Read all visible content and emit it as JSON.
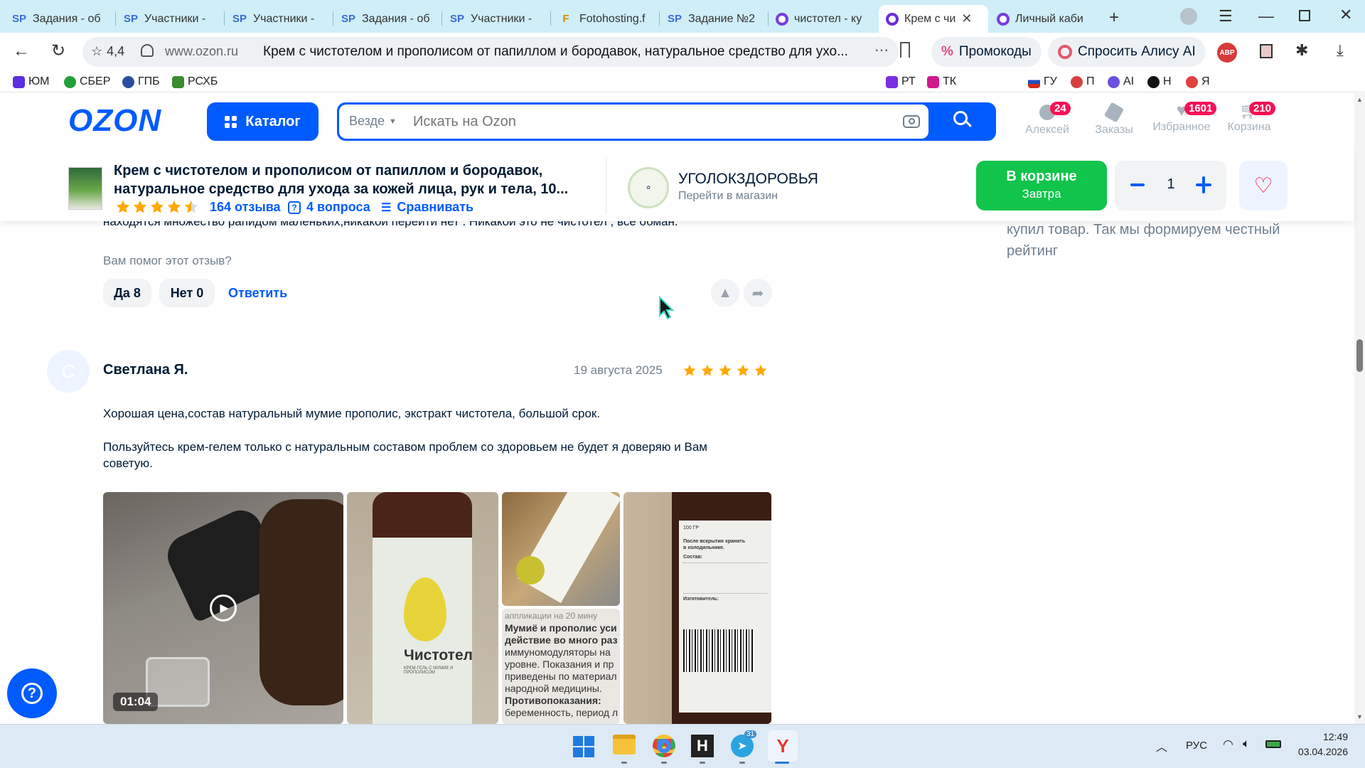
{
  "browser": {
    "tabs": [
      {
        "icon": "SP",
        "label": "Задания - об"
      },
      {
        "icon": "SP",
        "label": "Участники - "
      },
      {
        "icon": "SP",
        "label": "Участники - "
      },
      {
        "icon": "SP",
        "label": "Задания - об"
      },
      {
        "icon": "SP",
        "label": "Участники - "
      },
      {
        "icon": "F",
        "label": "Fotohosting.f"
      },
      {
        "icon": "SP",
        "label": "Задание №2"
      },
      {
        "icon": "ring",
        "label": "чистотел - ку"
      },
      {
        "icon": "ring",
        "label": "Крем с чи"
      },
      {
        "icon": "ring",
        "label": "Личный каби"
      }
    ],
    "rating": "4,4",
    "domain": "www.ozon.ru",
    "page_title": "Крем с чистотелом и прополисом от папиллом и бородавок, натуральное средство для ухо...",
    "promo_label": "Промокоды",
    "alice_label": "Спросить Алису AI",
    "bookmarks": [
      "ЮМ",
      "СБЕР",
      "ГПБ",
      "РСХБ",
      "РТ",
      "ТК",
      "ГУ",
      "П",
      "AI",
      "Н",
      "Я"
    ]
  },
  "ozon": {
    "logo": "OZON",
    "catalog_label": "Каталог",
    "search_scope": "Везде",
    "search_placeholder": "Искать на Ozon",
    "nav": [
      {
        "label": "Алексей",
        "badge": "24"
      },
      {
        "label": "Заказы",
        "badge": ""
      },
      {
        "label": "Избранное",
        "badge": "1601"
      },
      {
        "label": "Корзина",
        "badge": "210"
      }
    ],
    "product": {
      "title_line1": "Крем с чистотелом и прополисом от папиллом и бородавок,",
      "title_line2": "натуральное средство для ухода за кожей лица, рук и тела, 10...",
      "reviews_link": "164 отзыва",
      "questions_link": "4 вопроса",
      "compare_link": "Сравнивать",
      "seller_name": "УГОЛОКЗДОРОВЬЯ",
      "seller_link": "Перейти в магазин",
      "cart_button_line1": "В корзине",
      "cart_button_line2": "Завтра",
      "quantity": "1",
      "rating_value": 4.5
    }
  },
  "reviews": {
    "prev_text_tail": "находятся множество рапидом маленьких,никакой переити нет . Никакой это не чистотел , все обман.",
    "helpful_question": "Вам помог этот отзыв?",
    "yes_label": "Да 8",
    "no_label": "Нет 0",
    "reply_label": "Ответить",
    "side_text_line1": "купил товар. Так мы формируем честный",
    "side_text_line2": "рейтинг",
    "review": {
      "avatar_letter": "С",
      "author": "Светлана Я.",
      "date": "19 августа 2025",
      "stars": 5,
      "text1": "Хорошая цена,состав натуральный мумие прополис, экстракт чистотела, большой срок.",
      "text2": "Пользуйтесь крем-гелем только с натуральным составом проблем со здоровьем не будет я доверяю и Вам советую.",
      "video_duration": "01:04",
      "photo_label_bottle": "Чистотел",
      "photo_label_bottle_sub": "КРЕМ-ГЕЛЬ С МУМИЕ И ПРОПОЛИСОМ",
      "photo_text_leaflet_1": "Мумиё и прополис уси",
      "photo_text_leaflet_2": "действие во много раз",
      "photo_text_leaflet_3": "иммуномодуляторы на",
      "photo_text_leaflet_4": "уровне. Показания и пр",
      "photo_text_leaflet_5": "приведены по материал",
      "photo_text_leaflet_6": "народной медицины.",
      "photo_text_leaflet_7": "Противопоказания:",
      "photo_text_leaflet_8": "беременность, период л",
      "photo_text_leaflet_top": "аппликации на 20 мину",
      "photo_label_back_1": "После вскрытия хранить",
      "photo_label_back_2": "в холодильнике.",
      "photo_label_back_3": "Состав:",
      "photo_label_back_4": "Изготовитель:",
      "photo_label_back_vol": "100 ГР"
    }
  },
  "taskbar": {
    "lang": "РУС",
    "time": "12:49",
    "date": "03.04.2026",
    "telegram_badge": "31"
  },
  "colors": {
    "ozon_blue": "#005bff",
    "cart_green": "#10c44c",
    "star_orange": "#ffa800",
    "badge_pink": "#f91155"
  }
}
